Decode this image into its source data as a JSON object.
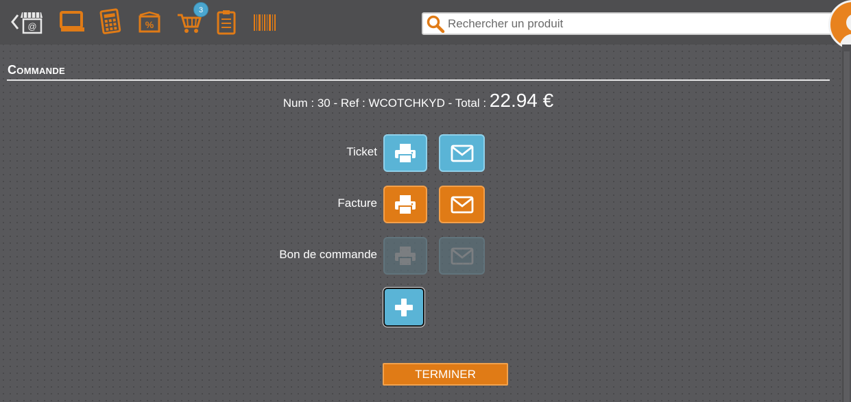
{
  "topbar": {
    "cart_count": "3",
    "search": {
      "placeholder": "Rechercher un produit"
    }
  },
  "section": {
    "title": "Commande"
  },
  "order": {
    "summary_prefix": "Num : 30 - Ref : WCOTCHKYD - Total : ",
    "total": "22.94 €"
  },
  "documents": [
    {
      "label": "Ticket",
      "style": "blue",
      "enabled": true
    },
    {
      "label": "Facture",
      "style": "orange",
      "enabled": true
    },
    {
      "label": "Bon de commande",
      "style": "disabled",
      "enabled": false
    }
  ],
  "actions": {
    "finish_label": "TERMINER"
  },
  "colors": {
    "accent": "#e07b16",
    "blue": "#5ab4d6",
    "background": "#58585b"
  },
  "icons": [
    "back-shop-icon",
    "screen-icon",
    "calculator-icon",
    "discount-icon",
    "cart-icon",
    "clipboard-icon",
    "barcode-icon",
    "search-icon",
    "print-icon",
    "mail-icon",
    "plus-icon",
    "user-avatar-icon"
  ]
}
